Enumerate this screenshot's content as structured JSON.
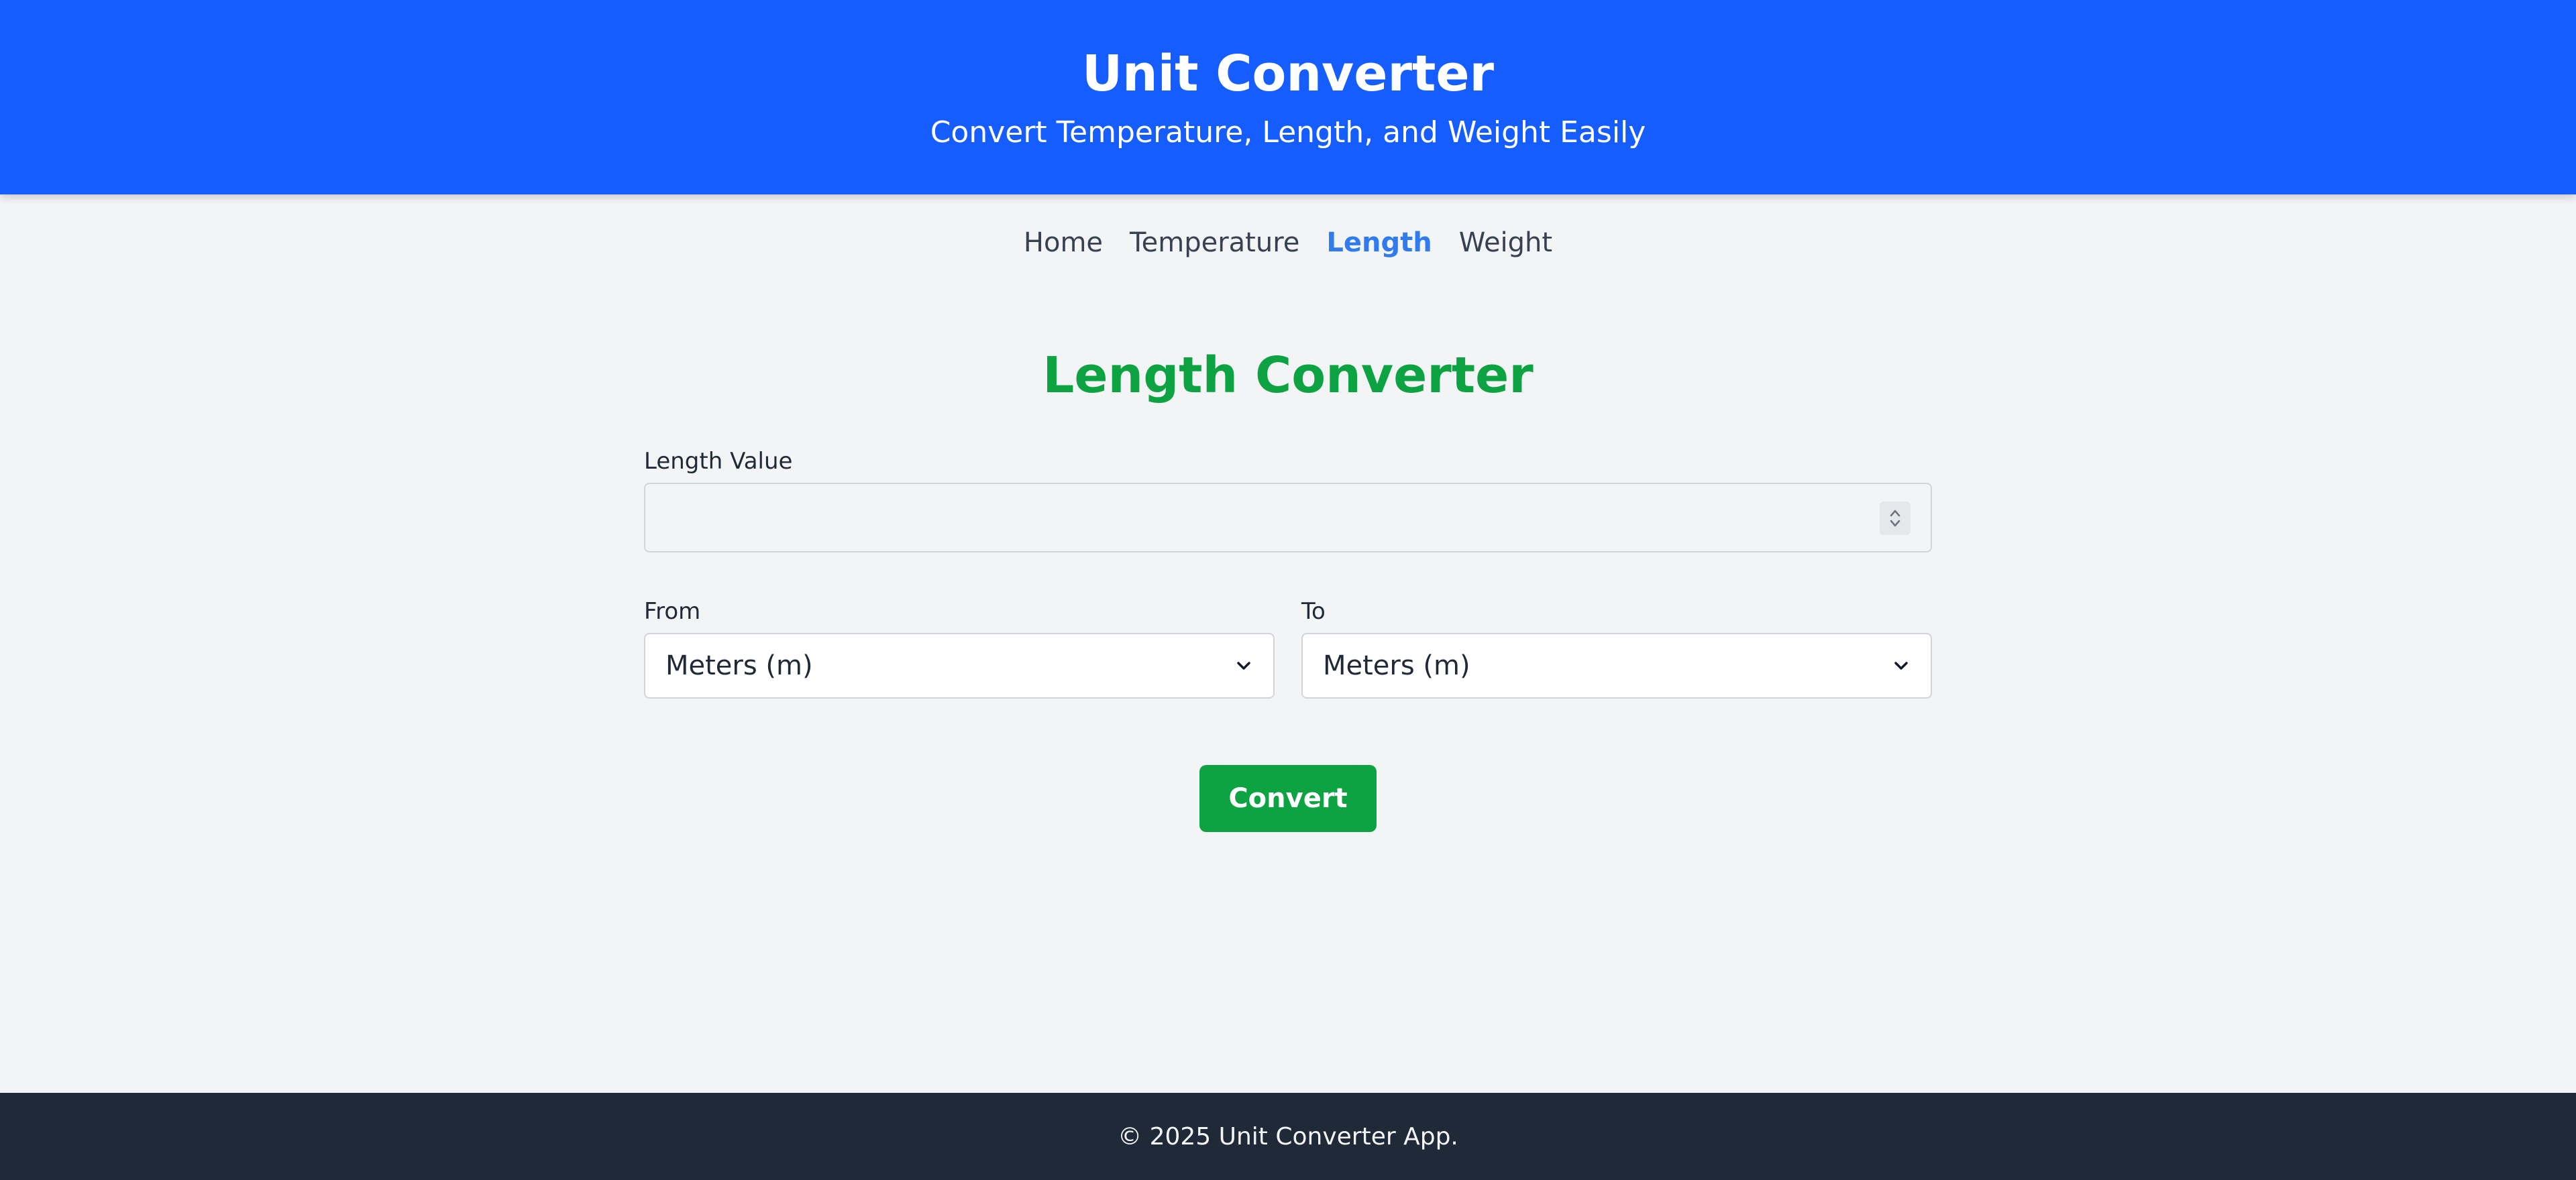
{
  "header": {
    "title": "Unit Converter",
    "subtitle": "Convert Temperature, Length, and Weight Easily"
  },
  "nav": {
    "items": [
      {
        "label": "Home",
        "active": false
      },
      {
        "label": "Temperature",
        "active": false
      },
      {
        "label": "Length",
        "active": true
      },
      {
        "label": "Weight",
        "active": false
      }
    ]
  },
  "converter": {
    "title": "Length Converter",
    "value_label": "Length Value",
    "value": "",
    "from_label": "From",
    "from_selected": "Meters (m)",
    "to_label": "To",
    "to_selected": "Meters (m)",
    "convert_label": "Convert"
  },
  "footer": {
    "text": "© 2025 Unit Converter App."
  },
  "colors": {
    "header_bg": "#165dff",
    "accent_green": "#0ea342",
    "nav_active": "#2f7bef",
    "footer_bg": "#1f2937",
    "page_bg": "#f3f4f6"
  },
  "icons": {
    "spinner": "up-down-stepper-icon",
    "select_arrow": "chevron-down-icon"
  }
}
